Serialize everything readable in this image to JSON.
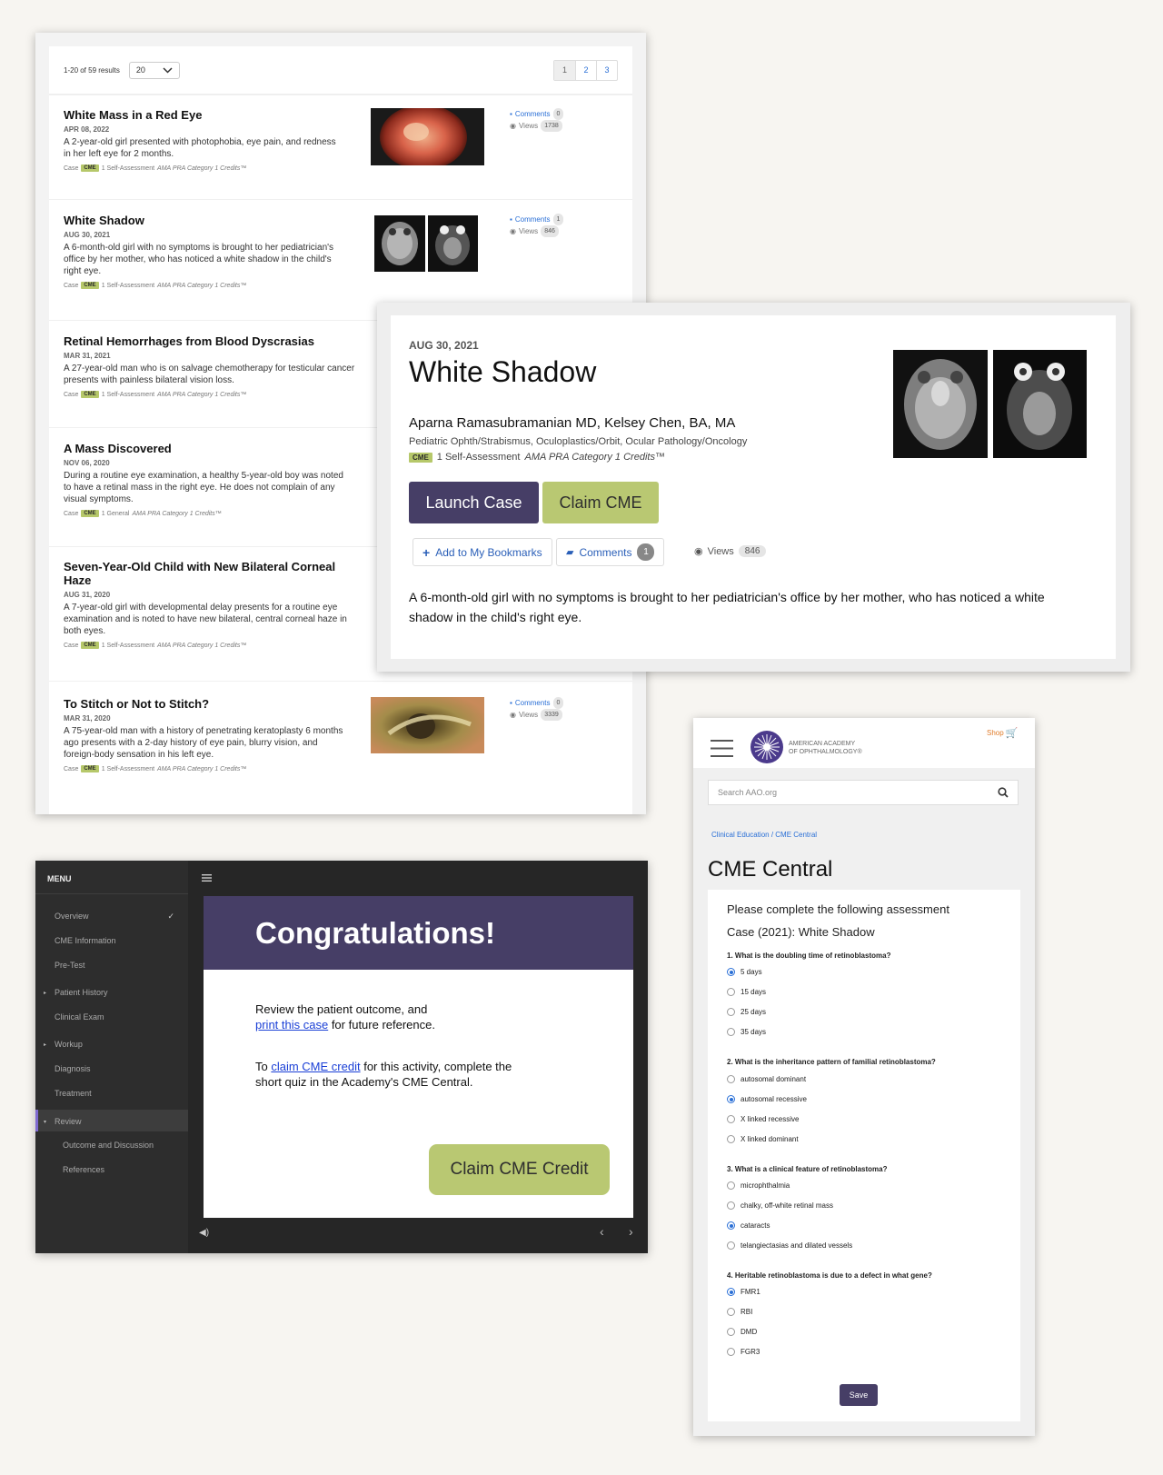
{
  "case_list": {
    "results_text": "1-20 of 59 results",
    "per_page": "20",
    "pages": [
      "1",
      "2",
      "3"
    ],
    "cases": [
      {
        "title": "White Mass in a Red Eye",
        "date": "APR 08, 2022",
        "desc": "A 2-year-old girl presented with photophobia, eye pain, and redness in her left eye for 2 months.",
        "tag_type": "Case",
        "cme": "CME",
        "credit_prefix": "1 Self-Assessment",
        "credit_italic": "AMA PRA Category 1 Credits™",
        "comments_label": "Comments",
        "comments": "0",
        "views_label": "Views",
        "views": "1738"
      },
      {
        "title": "White Shadow",
        "date": "AUG 30, 2021",
        "desc": "A 6-month-old girl with no symptoms is brought to her pediatrician's office by her mother, who has noticed a white shadow in the child's right eye.",
        "tag_type": "Case",
        "cme": "CME",
        "credit_prefix": "1 Self-Assessment",
        "credit_italic": "AMA PRA Category 1 Credits™",
        "comments_label": "Comments",
        "comments": "1",
        "views_label": "Views",
        "views": "846"
      },
      {
        "title": "Retinal Hemorrhages from Blood Dyscrasias",
        "date": "MAR 31, 2021",
        "desc": "A 27-year-old man who is on salvage chemotherapy for testicular cancer presents with painless bilateral vision loss.",
        "tag_type": "Case",
        "cme": "CME",
        "credit_prefix": "1 Self-Assessment",
        "credit_italic": "AMA PRA Category 1 Credits™"
      },
      {
        "title": "A Mass Discovered",
        "date": "NOV 06, 2020",
        "desc": "During a routine eye examination, a healthy 5-year-old boy was noted to have a retinal mass in the right eye. He does not complain of any visual symptoms.",
        "tag_type": "Case",
        "cme": "CME",
        "credit_prefix": "1 General",
        "credit_italic": "AMA PRA Category 1 Credits™"
      },
      {
        "title": "Seven-Year-Old Child with New Bilateral Corneal Haze",
        "date": "AUG 31, 2020",
        "desc": "A 7-year-old girl with developmental delay presents for a routine eye examination and is noted to have new bilateral, central corneal haze in both eyes.",
        "tag_type": "Case",
        "cme": "CME",
        "credit_prefix": "1 Self-Assessment",
        "credit_italic": "AMA PRA Category 1 Credits™"
      },
      {
        "title": "To Stitch or Not to Stitch?",
        "date": "MAR 31, 2020",
        "desc": "A 75-year-old man with a history of penetrating keratoplasty 6 months ago presents with a 2-day history of eye pain, blurry vision, and foreign-body sensation in his left eye.",
        "tag_type": "Case",
        "cme": "CME",
        "credit_prefix": "1 Self-Assessment",
        "credit_italic": "AMA PRA Category 1 Credits™",
        "comments_label": "Comments",
        "comments": "0",
        "views_label": "Views",
        "views": "3339"
      }
    ]
  },
  "detail": {
    "date": "AUG 30, 2021",
    "title": "White Shadow",
    "authors": "Aparna Ramasubramanian MD, Kelsey Chen, BA, MA",
    "specialties": "Pediatric Ophth/Strabismus, Oculoplastics/Orbit, Ocular Pathology/Oncology",
    "cme": "CME",
    "credit_prefix": "1 Self-Assessment",
    "credit_italic": "AMA PRA Category 1 Credits™",
    "launch_label": "Launch Case",
    "claim_label": "Claim CME",
    "bookmark_label": "Add to My Bookmarks",
    "comments_label": "Comments",
    "comments_count": "1",
    "views_label": "Views",
    "views_count": "846",
    "description": "A 6-month-old girl with no symptoms is brought to her pediatrician's office by her mother, who has noticed a white shadow in the child's right eye."
  },
  "viewer": {
    "menu_title": "MENU",
    "menu_items": [
      "Overview",
      "CME Information",
      "Pre-Test",
      "Patient History",
      "Clinical Exam",
      "Workup",
      "Diagnosis",
      "Treatment",
      "Review",
      "Outcome and Discussion",
      "References"
    ],
    "slide_title": "Congratulations!",
    "p1_text": "Review the patient outcome, and",
    "p1_link": "print this case",
    "p1_suffix": " for future reference.",
    "p2_prefix": "To ",
    "p2_link": "claim CME credit",
    "p2_suffix": " for this activity, complete the short quiz in the Academy's CME Central.",
    "claim_button": "Claim CME Credit"
  },
  "mobile": {
    "org_line1": "AMERICAN ACADEMY",
    "org_line2": "OF OPHTHALMOLOGY®",
    "shop_label": "Shop",
    "search_placeholder": "Search AAO.org",
    "breadcrumb": "Clinical Education / CME Central",
    "page_title": "CME Central",
    "intro_line1": "Please complete the following assessment",
    "intro_line2": "Case (2021): White Shadow",
    "questions": [
      {
        "q": "1. What is the doubling time of retinoblastoma?",
        "options": [
          "5 days",
          "15 days",
          "25 days",
          "35 days"
        ],
        "selected": 0
      },
      {
        "q": "2. What is the inheritance pattern of familial retinoblastoma?",
        "options": [
          "autosomal dominant",
          "autosomal recessive",
          "X linked recessive",
          "X linked dominant"
        ],
        "selected": 1
      },
      {
        "q": "3. What is a clinical feature of retinoblastoma?",
        "options": [
          "microphthalmia",
          "chalky, off-white retinal mass",
          "cataracts",
          "telangiectasias and dilated vessels"
        ],
        "selected": 2
      },
      {
        "q": "4. Heritable retinoblastoma is due to a defect in what gene?",
        "options": [
          "FMR1",
          "RBI",
          "DMD",
          "FGR3"
        ],
        "selected": 0
      }
    ],
    "save_label": "Save"
  },
  "colors": {
    "brand_purple": "#463e66",
    "cme_green": "#b9c872",
    "link_blue": "#2a6fd6"
  }
}
